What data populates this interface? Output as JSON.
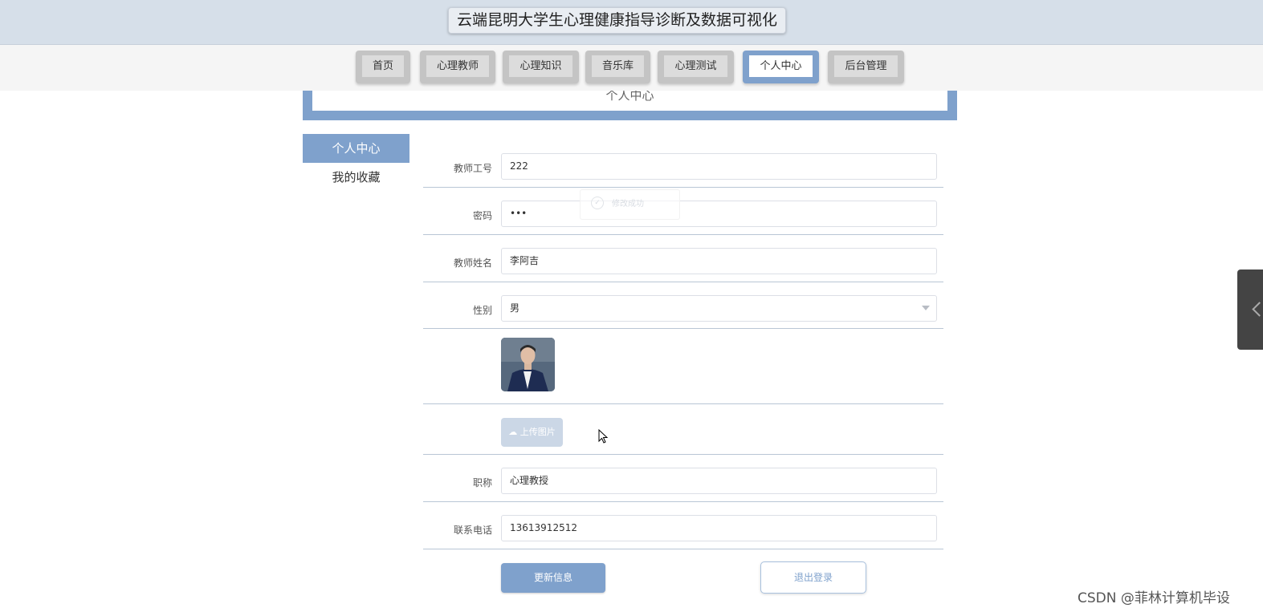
{
  "header": {
    "title": "云端昆明大学生心理健康指导诊断及数据可视化"
  },
  "nav": {
    "items": [
      {
        "label": "首页"
      },
      {
        "label": "心理教师"
      },
      {
        "label": "心理知识"
      },
      {
        "label": "音乐库"
      },
      {
        "label": "心理测试"
      },
      {
        "label": "个人中心",
        "active": true
      },
      {
        "label": "后台管理"
      }
    ]
  },
  "banner": {
    "title": "个人中心"
  },
  "sidebar": {
    "items": [
      {
        "label": "个人中心",
        "active": true
      },
      {
        "label": "我的收藏"
      }
    ]
  },
  "form": {
    "teacher_id": {
      "label": "教师工号",
      "value": "222"
    },
    "password": {
      "label": "密码",
      "value": "•••"
    },
    "teacher_name": {
      "label": "教师姓名",
      "value": "李阿吉"
    },
    "gender": {
      "label": "性别",
      "value": "男"
    },
    "upload": {
      "label": "上传图片"
    },
    "title": {
      "label": "职称",
      "value": "心理教授"
    },
    "phone": {
      "label": "联系电话",
      "value": "13613912512"
    }
  },
  "toast": {
    "icon": "check-circle-icon",
    "text": "修改成功"
  },
  "buttons": {
    "update": "更新信息",
    "logout": "退出登录"
  },
  "watermark": "CSDN @菲林计算机毕设",
  "colors": {
    "accent": "#7fa1cc",
    "header_bg": "#d6dfe9",
    "nav_bg": "#f5f5f5"
  }
}
